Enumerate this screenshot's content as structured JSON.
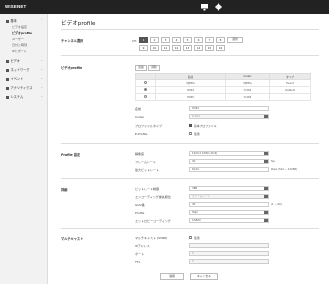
{
  "brand": "WISENET",
  "header": {
    "monitor_icon": "monitor-icon",
    "settings_icon": "gear-icon"
  },
  "sidebar": {
    "items": [
      {
        "label": "基本",
        "icon": "info-icon"
      },
      {
        "label": "ビデオ",
        "icon": "video-icon"
      },
      {
        "label": "ネットワーク",
        "icon": "network-icon"
      },
      {
        "label": "イベント",
        "icon": "event-icon"
      },
      {
        "label": "アナリティクス",
        "icon": "analytics-icon"
      },
      {
        "label": "システム",
        "icon": "system-icon"
      }
    ],
    "subitems": [
      "ビデオ設定",
      "ビデオprofile",
      "ユーザー",
      "日付と時刻",
      "IPとポート"
    ]
  },
  "page_title": "ビデオprofile",
  "channel": {
    "label": "チャンネル選択",
    "ch_label": "CH",
    "buttons": [
      "1",
      "2",
      "3",
      "4",
      "5",
      "6",
      "7",
      "8",
      "9",
      "10",
      "11",
      "12",
      "13",
      "14",
      "15",
      "16"
    ],
    "selected": "1",
    "save_btn": "適用"
  },
  "profile": {
    "section": "ビデオprofile",
    "add_btn": "追加",
    "delete_btn": "削除",
    "table": {
      "headers": [
        "",
        "名前",
        "Codec",
        "タイプ"
      ],
      "rows": [
        {
          "name": "MJPEG",
          "codec": "MJPEG",
          "type": "Event",
          "selected": false
        },
        {
          "name": "H264",
          "codec": "H.264",
          "type": "Default",
          "selected": true
        },
        {
          "name": "H265",
          "codec": "H.265",
          "type": "",
          "selected": false
        }
      ]
    },
    "name_label": "名前",
    "name_value": "H264",
    "codec_label": "Codec",
    "codec_value": "H.264",
    "fixed_label": "プロファイルタイプ",
    "fixed_option": "基本プロファイル",
    "e_label": "E-Profile",
    "e_option": "使用"
  },
  "profile_settings": {
    "section": "Profile 設定",
    "res_label": "解像度",
    "res_value": "1920 X 1080 (16:9)",
    "fps_label": "フレームレート",
    "fps_value": "30",
    "fps_unit": "fps",
    "bitrate_label": "最大ビットレート",
    "bitrate_value": "6144",
    "bitrate_note": "kbps (512 ~ 12288)"
  },
  "advanced": {
    "section": "詳細",
    "bitrate_ctrl_label": "ビットレート制御",
    "bitrate_ctrl_value": "VBR",
    "priority_label": "エンコーディング優先順位",
    "priority_value": "フレームレート",
    "gov_label": "GOV長",
    "gov_value": "30",
    "gov_note": "(1 ~ 60)",
    "profile_label": "Profile",
    "profile_value": "High",
    "entropy_label": "エントロピーコーディング",
    "entropy_value": "CABAC"
  },
  "multicast": {
    "section": "マルチキャスト",
    "svnp_label": "マルチキャスト (SVNP)",
    "svnp_option": "使用",
    "ip_label": "IPアドレス",
    "port_label": "ポート",
    "ttl_label": "TTL",
    "ip_value": "",
    "port_value": "0",
    "ttl_value": "5"
  },
  "footer": {
    "apply": "適用",
    "cancel": "キャンセル"
  }
}
